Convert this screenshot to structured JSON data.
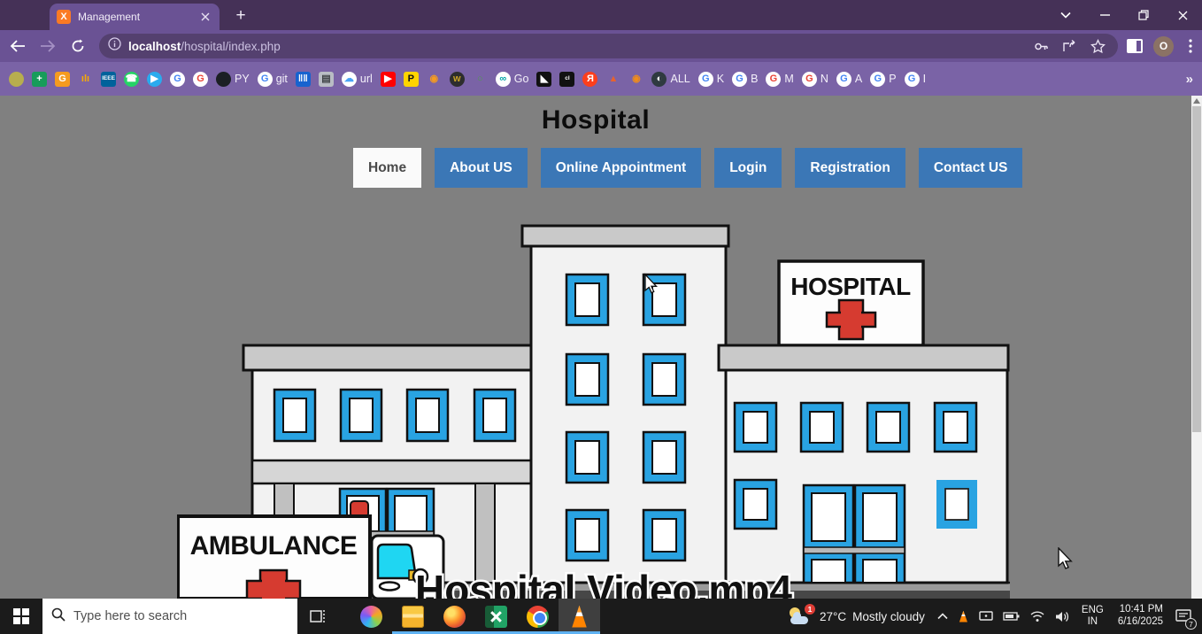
{
  "browser": {
    "tab_title": "Management",
    "url_host": "localhost",
    "url_path": "/hospital/index.php",
    "profile_initial": "O",
    "new_tab_glyph": "+"
  },
  "bookmarks_overflow": "»",
  "bookmarks": [
    {
      "name": "palette",
      "glyph": "",
      "bg": "#b7ae4e",
      "fg": "#2e5d32"
    },
    {
      "name": "sheets",
      "glyph": "+",
      "bg": "#179c5a",
      "fg": "#ffffff",
      "shape": "sq"
    },
    {
      "name": "orange-g",
      "glyph": "G",
      "bg": "#f59b1f",
      "fg": "#ffffff",
      "shape": "sq"
    },
    {
      "name": "analytics",
      "glyph": "ılı",
      "bg": "transparent",
      "fg": "#f9ab00"
    },
    {
      "name": "ieee",
      "glyph": "IEEE",
      "bg": "#00629b",
      "fg": "#ffffff",
      "shape": "sq",
      "small": true
    },
    {
      "name": "whatsapp",
      "glyph": "☎",
      "bg": "#25d366",
      "fg": "#ffffff"
    },
    {
      "name": "telegram",
      "glyph": "▶",
      "bg": "#2aabee",
      "fg": "#ffffff"
    },
    {
      "name": "google-1",
      "glyph": "G",
      "bg": "#ffffff",
      "fg": "#4285f4"
    },
    {
      "name": "google-2",
      "glyph": "G",
      "bg": "#ffffff",
      "fg": "#ea4335"
    },
    {
      "name": "github",
      "glyph": "",
      "bg": "#1b1f24",
      "fg": "#ffffff",
      "label": "PY"
    },
    {
      "name": "google-git",
      "glyph": "G",
      "bg": "#ffffff",
      "fg": "#4285f4",
      "label": "git"
    },
    {
      "name": "barcode",
      "glyph": "‖‖",
      "bg": "#1763cf",
      "fg": "#ffffff",
      "shape": "sq"
    },
    {
      "name": "briefcase",
      "glyph": "▤",
      "bg": "#b9bdc4",
      "fg": "#3c4043",
      "shape": "sq"
    },
    {
      "name": "cloud-url",
      "glyph": "☁",
      "bg": "#ffffff",
      "fg": "#4aa3f5",
      "label": "url"
    },
    {
      "name": "youtube",
      "glyph": "▶",
      "bg": "#ff0000",
      "fg": "#ffffff",
      "shape": "sq"
    },
    {
      "name": "pngtree",
      "glyph": "P",
      "bg": "#ffd400",
      "fg": "#111111",
      "shape": "sq"
    },
    {
      "name": "film-camera",
      "glyph": "◉",
      "bg": "transparent",
      "fg": "#f59b1f"
    },
    {
      "name": "cart",
      "glyph": "w",
      "bg": "#2d2d2d",
      "fg": "#c9a227"
    },
    {
      "name": "ring",
      "glyph": "○",
      "bg": "transparent",
      "fg": "#4f9e4b"
    },
    {
      "name": "godaddy",
      "glyph": "∞",
      "bg": "#ffffff",
      "fg": "#00a4a6",
      "label": "Go"
    },
    {
      "name": "bird",
      "glyph": "◣",
      "bg": "#111111",
      "fg": "#ffffff",
      "shape": "sq"
    },
    {
      "name": "cl",
      "glyph": "cl",
      "bg": "#111111",
      "fg": "#ffffff",
      "shape": "sq",
      "small": true
    },
    {
      "name": "yandex",
      "glyph": "Я",
      "bg": "#fc3f1d",
      "fg": "#ffffff"
    },
    {
      "name": "matlab",
      "glyph": "▲",
      "bg": "transparent",
      "fg": "#e8622d"
    },
    {
      "name": "eye",
      "glyph": "◉",
      "bg": "transparent",
      "fg": "#f08c1a"
    },
    {
      "name": "globe-all",
      "glyph": "◐",
      "bg": "#2f3a40",
      "fg": "#ffffff",
      "label": "ALL"
    },
    {
      "name": "google-k",
      "glyph": "G",
      "bg": "#ffffff",
      "fg": "#4285f4",
      "label": "K"
    },
    {
      "name": "google-b",
      "glyph": "G",
      "bg": "#ffffff",
      "fg": "#4285f4",
      "label": "B"
    },
    {
      "name": "google-m",
      "glyph": "G",
      "bg": "#ffffff",
      "fg": "#ea4335",
      "label": "M"
    },
    {
      "name": "google-n",
      "glyph": "G",
      "bg": "#ffffff",
      "fg": "#ea4335",
      "label": "N"
    },
    {
      "name": "google-a",
      "glyph": "G",
      "bg": "#ffffff",
      "fg": "#4285f4",
      "label": "A"
    },
    {
      "name": "google-p",
      "glyph": "G",
      "bg": "#ffffff",
      "fg": "#4285f4",
      "label": "P"
    },
    {
      "name": "google-i",
      "glyph": "G",
      "bg": "#ffffff",
      "fg": "#4285f4",
      "label": "I"
    }
  ],
  "page": {
    "title": "Hospital",
    "nav": [
      {
        "label": "Home",
        "active": true
      },
      {
        "label": "About US",
        "active": false
      },
      {
        "label": "Online Appointment",
        "active": false
      },
      {
        "label": "Login",
        "active": false
      },
      {
        "label": "Registration",
        "active": false
      },
      {
        "label": "Contact US",
        "active": false
      }
    ],
    "hospital_sign": "HOSPITAL",
    "ambulance_sign": "AMBULANCE",
    "video_caption": "Hospital Video.mp4"
  },
  "taskbar": {
    "search_placeholder": "Type here to search",
    "apps": [
      {
        "name": "copilot",
        "running": false,
        "active": false
      },
      {
        "name": "explorer",
        "running": true,
        "active": false
      },
      {
        "name": "firefox",
        "running": true,
        "active": false
      },
      {
        "name": "excel",
        "running": true,
        "active": false
      },
      {
        "name": "chrome",
        "running": true,
        "active": false
      },
      {
        "name": "vlc",
        "running": true,
        "active": true
      }
    ],
    "tray": {
      "weather_badge": "1",
      "temperature": "27°C",
      "condition": "Mostly cloudy",
      "lang_top": "ENG",
      "lang_bottom": "IN",
      "time": "10:41 PM",
      "date": "6/16/2025",
      "notification_count": "7"
    }
  },
  "colors": {
    "theme_purple_dark": "#453157",
    "theme_purple": "#6a5294",
    "bookmarks_purple": "#7a63a6",
    "page_bg": "#808080",
    "nav_blue": "#3b77b6",
    "window_blue": "#29a3e2",
    "cross_red": "#d63b30",
    "taskbar_dark": "#1b1b1b",
    "run_indicator_blue": "#5fb2f2"
  }
}
